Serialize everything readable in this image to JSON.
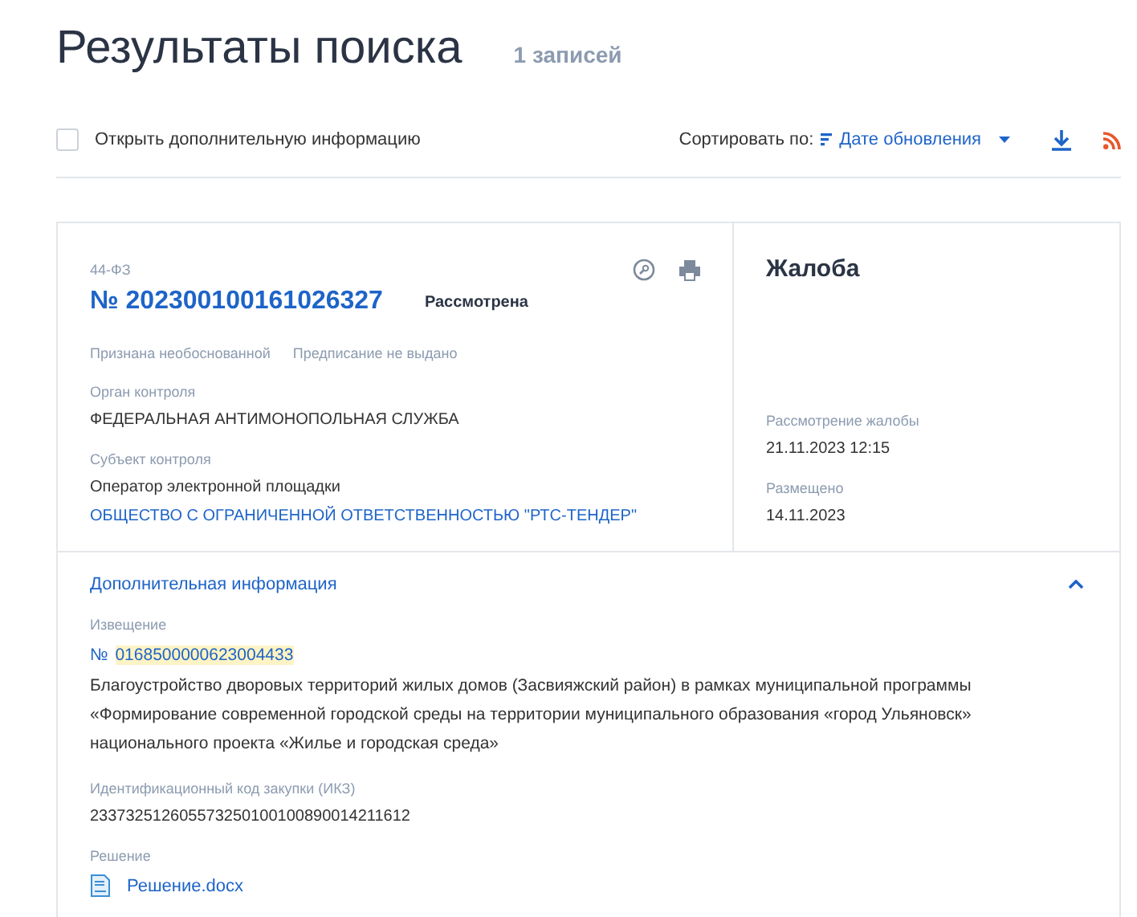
{
  "title": "Результаты поиска",
  "count": "1 записей",
  "toolbar": {
    "checkbox": {
      "label": "Открыть дополнительную информацию",
      "checked": false
    },
    "sort_label": "Сортировать по:",
    "sort_value": "Дате обновления"
  },
  "card": {
    "law": "44-ФЗ",
    "number": "№ 202300100161026327",
    "status": "Рассмотрена",
    "tags": [
      "Признана необоснованной",
      "Предписание не выдано"
    ],
    "fields": [
      {
        "label": "Орган контроля",
        "lines": [
          {
            "text": "ФЕДЕРАЛЬНАЯ АНТИМОНОПОЛЬНАЯ СЛУЖБА",
            "kind": "text"
          }
        ]
      },
      {
        "label": "Субъект контроля",
        "lines": [
          {
            "text": "Оператор электронной площадки",
            "kind": "text"
          },
          {
            "text": "ОБЩЕСТВО С ОГРАНИЧЕННОЙ ОТВЕТСТВЕННОСТЬЮ \"РТС-ТЕНДЕР\"",
            "kind": "link"
          }
        ]
      }
    ],
    "type": "Жалоба",
    "dates": [
      {
        "label": "Рассмотрение жалобы",
        "value": "21.11.2023 12:15"
      },
      {
        "label": "Размещено",
        "value": "14.11.2023"
      }
    ],
    "extra": {
      "title": "Дополнительная информация",
      "expanded": true,
      "notice_label": "Извещение",
      "notice_prefix": "№",
      "notice_number": "0168500000623004433",
      "notice_text": "Благоустройство дворовых территорий жилых домов (Засвияжский район) в рамках муниципальной программы «Формирование современной городской среды на территории муниципального образования «город Ульяновск» национального проекта «Жилье и городская среда»",
      "ikz_label": "Идентификационный код закупки (ИКЗ)",
      "ikz": "233732512605573250100100890014211612",
      "decision_label": "Решение",
      "decision_file": "Решение.docx"
    }
  }
}
